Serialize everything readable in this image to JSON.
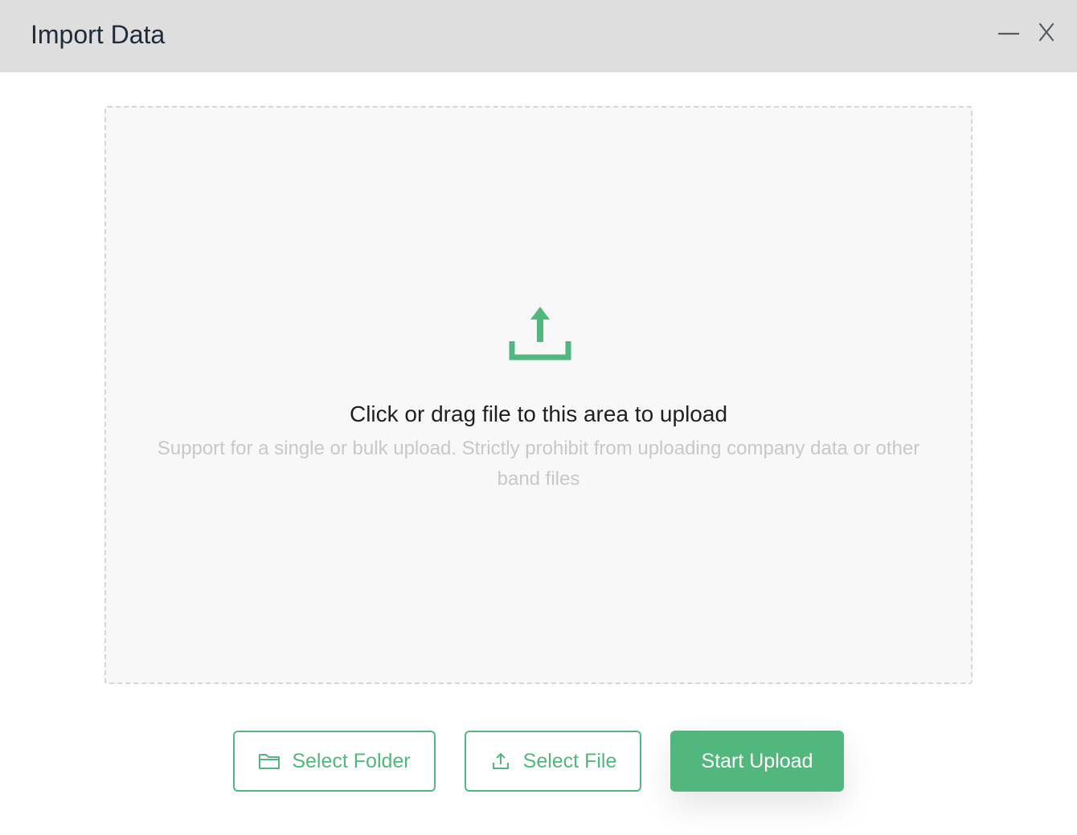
{
  "window": {
    "title": "Import Data",
    "minimize_icon": "minimize-icon",
    "close_icon": "close-icon"
  },
  "dropzone": {
    "icon": "upload-icon",
    "title": "Click or drag file to this area to upload",
    "hint": "Support for a single or bulk upload. Strictly prohibit from uploading company data or other band files"
  },
  "actions": {
    "select_folder": {
      "label": "Select Folder",
      "icon": "folder-icon"
    },
    "select_file": {
      "label": "Select File",
      "icon": "upload-icon"
    },
    "start_upload": {
      "label": "Start Upload"
    }
  },
  "colors": {
    "accent": "#52b77c",
    "titlebar": "#dedede",
    "dropzone_bg": "#f8f8f8",
    "dropzone_border": "#d6d6d6"
  }
}
